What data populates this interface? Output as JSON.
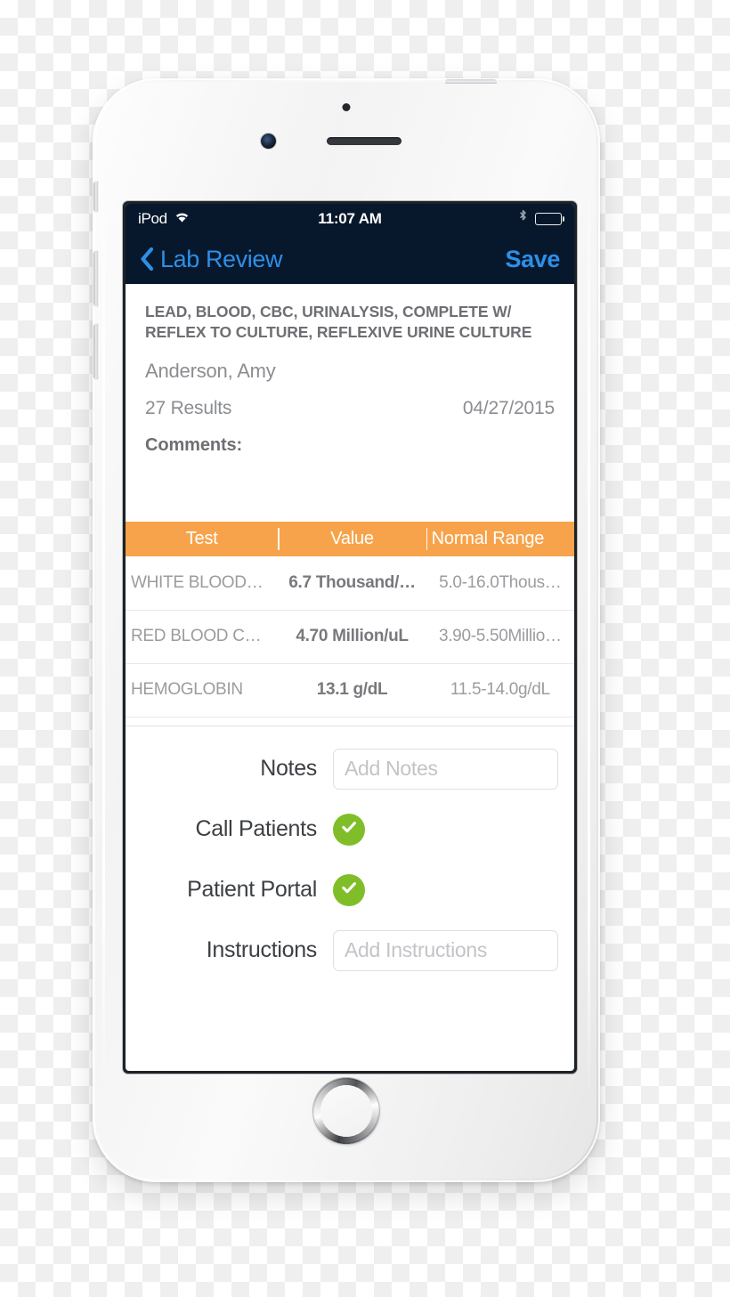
{
  "status_bar": {
    "carrier": "iPod",
    "wifi_icon": "wifi-icon",
    "time": "11:07 AM",
    "bluetooth_icon": "bluetooth-icon",
    "battery_icon": "battery-full-icon"
  },
  "nav_bar": {
    "back_icon": "chevron-left-icon",
    "back_label": "Lab Review",
    "save_label": "Save",
    "background_color": "#07182c",
    "tint_color": "#2d8fe8"
  },
  "info": {
    "lab_title": "LEAD, BLOOD, CBC, URINALYSIS, COMPLETE W/ REFLEX TO CULTURE, REFLEXIVE URINE CULTURE",
    "patient_name": "Anderson, Amy",
    "result_count": "27 Results",
    "date": "04/27/2015",
    "comments_label": "Comments:",
    "comments_value": ""
  },
  "results_table": {
    "header_color": "#f7a34b",
    "columns": [
      "Test",
      "Value",
      "Normal Range"
    ],
    "rows": [
      {
        "test": "WHITE BLOOD…",
        "value": "6.7 Thousand/…",
        "range": "5.0-16.0Thous…"
      },
      {
        "test": "RED BLOOD C…",
        "value": "4.70 Million/uL",
        "range": "3.90-5.50Millio…"
      },
      {
        "test": "HEMOGLOBIN",
        "value": "13.1 g/dL",
        "range": "11.5-14.0g/dL"
      }
    ]
  },
  "form": {
    "check_color": "#7fbe28",
    "notes_label": "Notes",
    "notes_placeholder": "Add Notes",
    "notes_value": "",
    "call_patients_label": "Call Patients",
    "call_patients_checked": true,
    "patient_portal_label": "Patient Portal",
    "patient_portal_checked": true,
    "instructions_label": "Instructions",
    "instructions_placeholder": "Add Instructions",
    "instructions_value": ""
  }
}
